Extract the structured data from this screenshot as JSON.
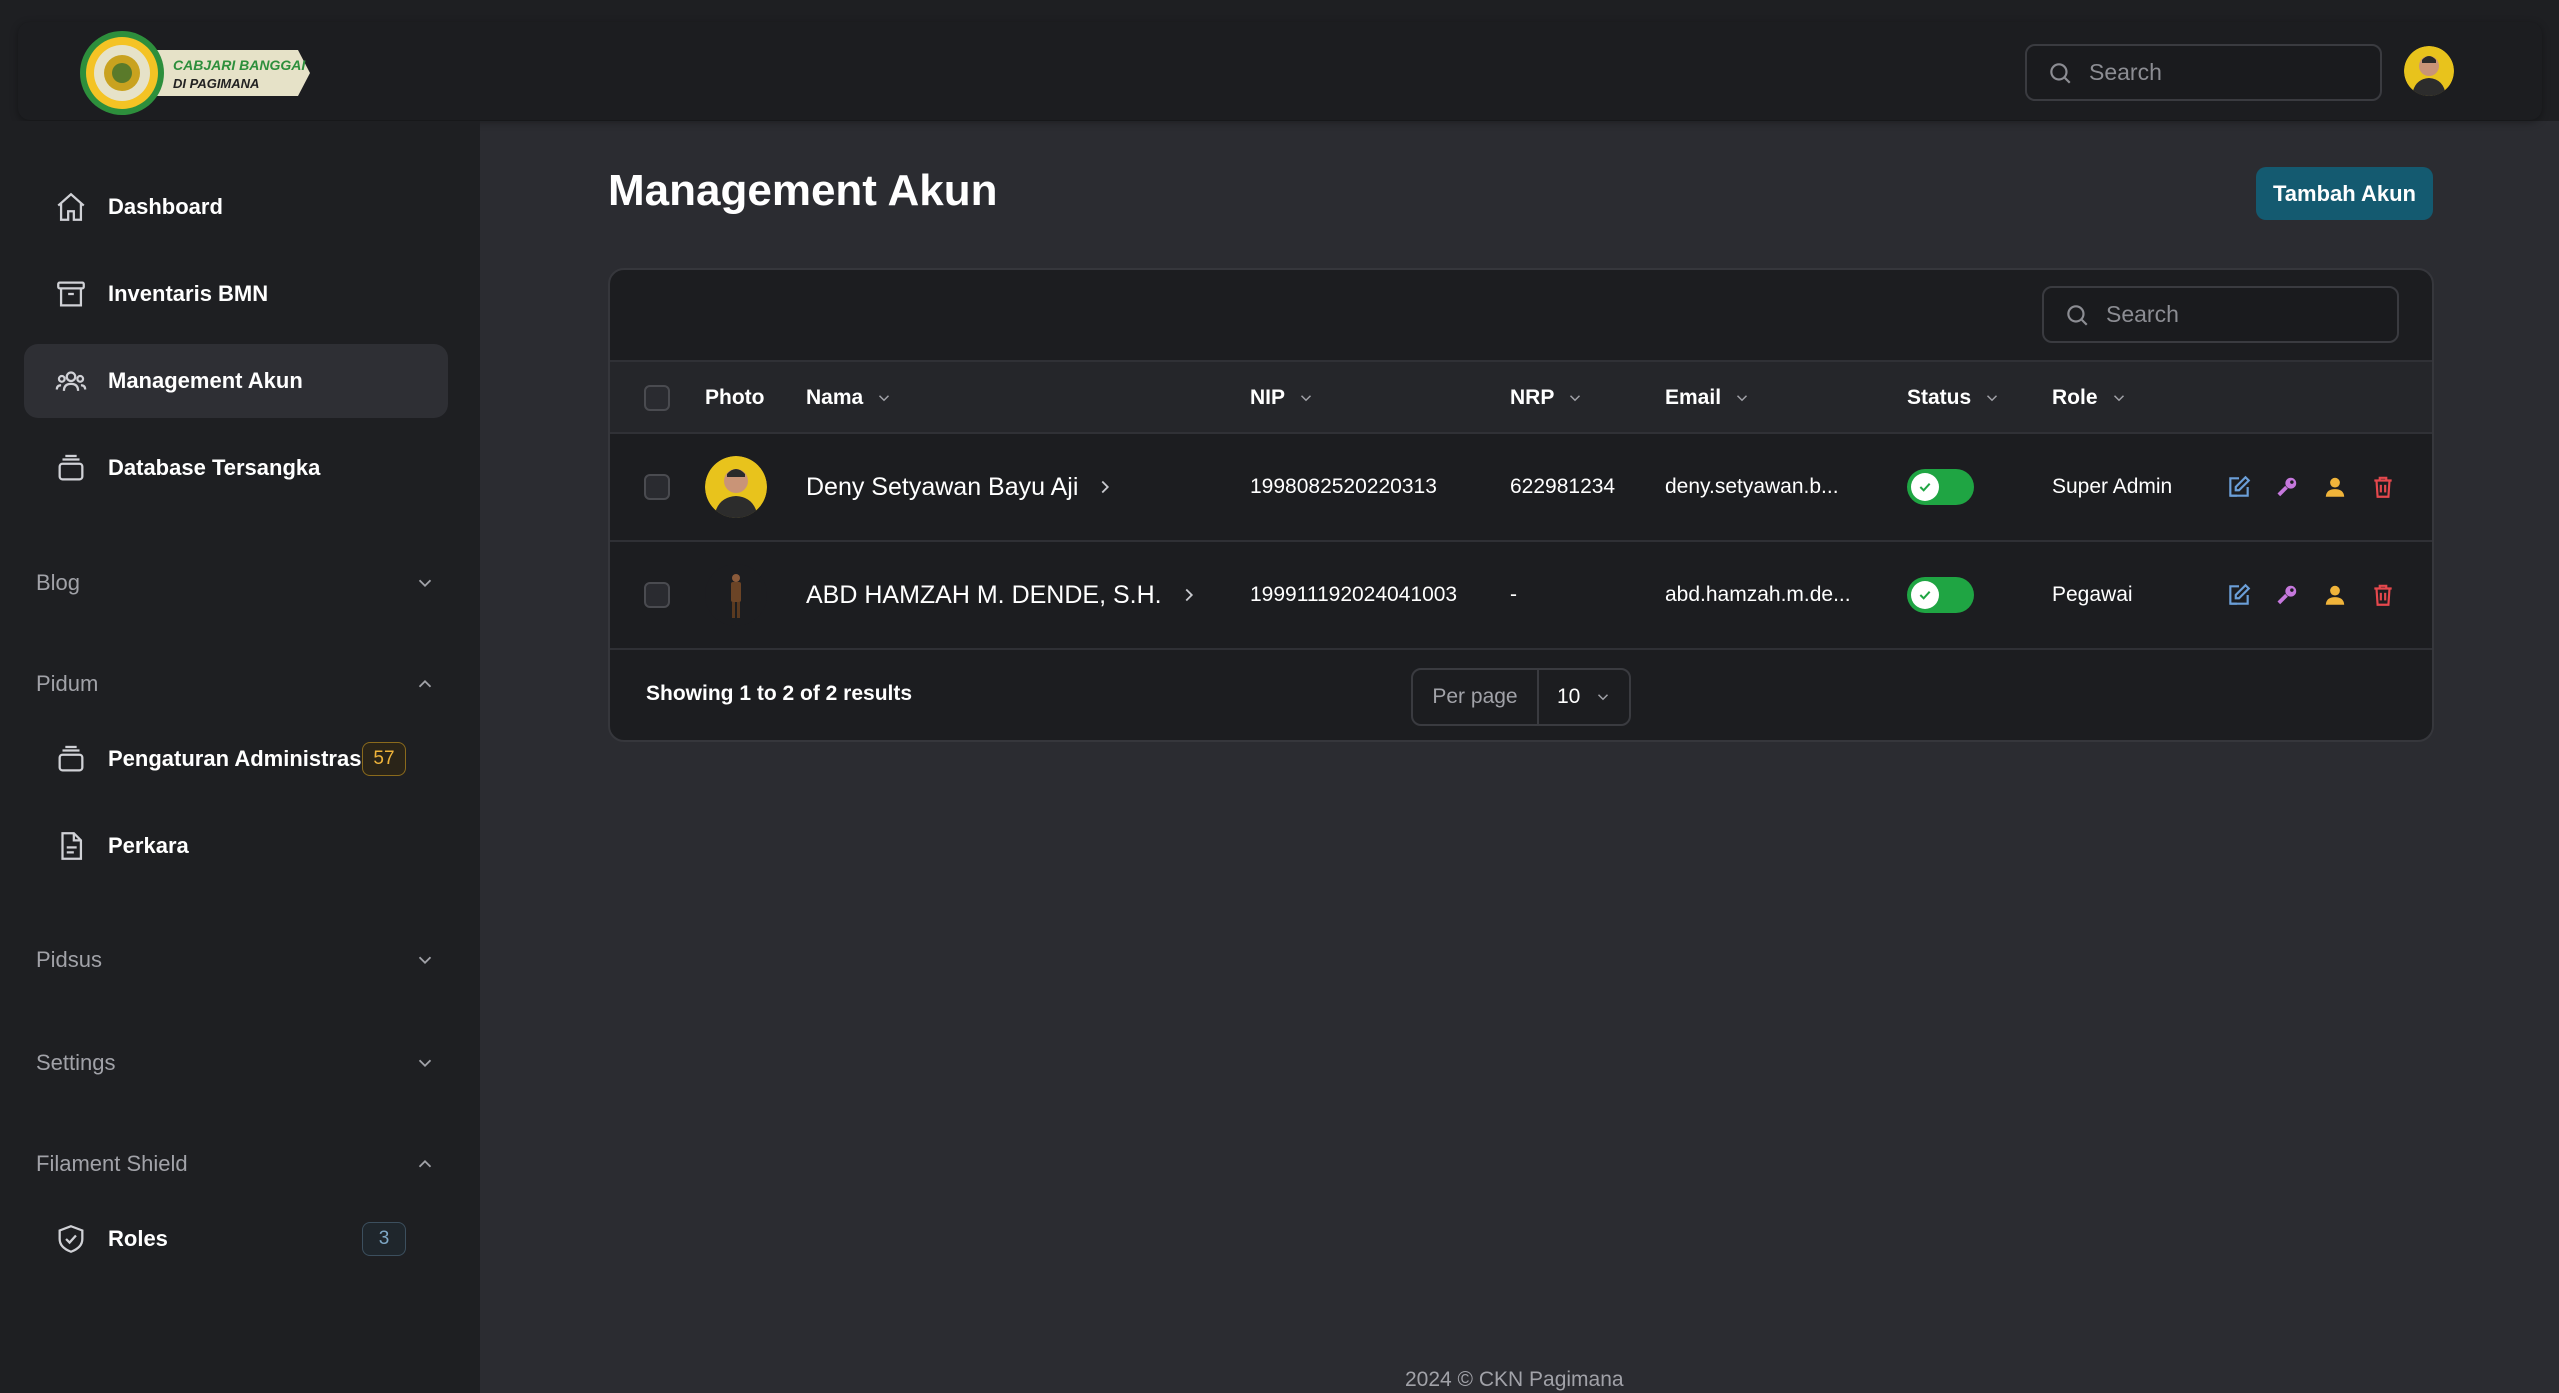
{
  "brand": {
    "line1": "CABJARI BANGGAI",
    "line2": "DI PAGIMANA"
  },
  "topbar": {
    "search_placeholder": "Search"
  },
  "sidebar": {
    "items": [
      {
        "label": "Dashboard",
        "icon": "home-icon"
      },
      {
        "label": "Inventaris BMN",
        "icon": "archive-icon"
      },
      {
        "label": "Management Akun",
        "icon": "users-icon",
        "active": true
      },
      {
        "label": "Database Tersangka",
        "icon": "database-icon"
      }
    ],
    "groups": {
      "blog": {
        "label": "Blog",
        "expanded": false
      },
      "pidum": {
        "label": "Pidum",
        "expanded": true,
        "items": [
          {
            "label": "Pengaturan Administrasi",
            "badge": "57"
          },
          {
            "label": "Perkara"
          }
        ]
      },
      "pidsus": {
        "label": "Pidsus",
        "expanded": false
      },
      "settings": {
        "label": "Settings",
        "expanded": false
      },
      "shield": {
        "label": "Filament Shield",
        "expanded": true,
        "items": [
          {
            "label": "Roles",
            "badge": "3"
          }
        ]
      }
    }
  },
  "page": {
    "title": "Management Akun",
    "add_button": "Tambah Akun"
  },
  "table": {
    "search_placeholder": "Search",
    "columns": [
      "Photo",
      "Nama",
      "NIP",
      "NRP",
      "Email",
      "Status",
      "Role"
    ],
    "rows": [
      {
        "nama": "Deny Setyawan Bayu Aji",
        "nip": "1998082520220313",
        "nrp": "622981234",
        "email": "deny.setyawan.b...",
        "status": true,
        "role": "Super Admin"
      },
      {
        "nama": "ABD HAMZAH M. DENDE, S.H.",
        "nip": "199911192024041003",
        "nrp": "-",
        "email": "abd.hamzah.m.de...",
        "status": true,
        "role": "Pegawai"
      }
    ],
    "summary": "Showing 1 to 2 of 2 results",
    "per_page_label": "Per page",
    "per_page_value": "10"
  },
  "footer": {
    "copyright": "2024 © CKN Pagimana"
  },
  "colors": {
    "accent": "#145a70",
    "toggle_on": "#1fa543",
    "delete": "#e5484d",
    "key": "#c678dd",
    "user": "#f0b43a",
    "edit": "#6b9fd8"
  }
}
